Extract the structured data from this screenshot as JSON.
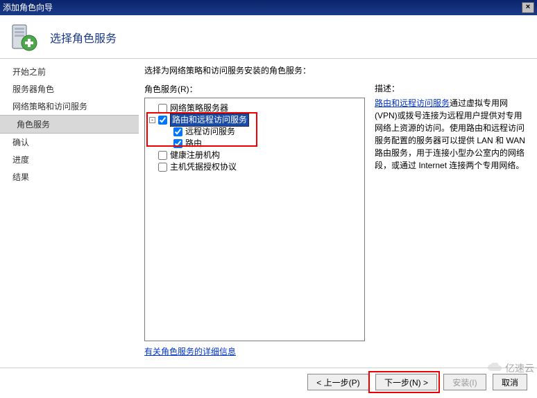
{
  "window": {
    "title": "添加角色向导"
  },
  "header": {
    "title": "选择角色服务"
  },
  "sidebar": {
    "items": [
      {
        "label": "开始之前"
      },
      {
        "label": "服务器角色"
      },
      {
        "label": "网络策略和访问服务"
      },
      {
        "label": "角色服务",
        "active": true
      },
      {
        "label": "确认"
      },
      {
        "label": "进度"
      },
      {
        "label": "结果"
      }
    ]
  },
  "main": {
    "prompt": "选择为网络策略和访问服务安装的角色服务：",
    "tree_heading": "角色服务(R)：",
    "tree": [
      {
        "label": "网络策略服务器",
        "checked": false,
        "level": 0,
        "toggler": ""
      },
      {
        "label": "路由和远程访问服务",
        "checked": true,
        "level": 0,
        "toggler": "-",
        "selected": true
      },
      {
        "label": "远程访问服务",
        "checked": true,
        "level": 1,
        "toggler": ""
      },
      {
        "label": "路由",
        "checked": true,
        "level": 1,
        "toggler": ""
      },
      {
        "label": "健康注册机构",
        "checked": false,
        "level": 0,
        "toggler": ""
      },
      {
        "label": "主机凭据授权协议",
        "checked": false,
        "level": 0,
        "toggler": ""
      }
    ],
    "details_link": "有关角色服务的详细信息",
    "desc_heading": "描述：",
    "desc_link": "路由和远程访问服务",
    "desc_text": "通过虚拟专用网(VPN)或拨号连接为远程用户提供对专用网络上资源的访问。使用路由和远程访问服务配置的服务器可以提供 LAN 和 WAN 路由服务，用于连接小型办公室内的网络段，或通过 Internet 连接两个专用网络。"
  },
  "footer": {
    "prev": "< 上一步(P)",
    "next": "下一步(N) >",
    "install": "安装(I)",
    "cancel": "取消"
  },
  "watermark": "亿速云"
}
